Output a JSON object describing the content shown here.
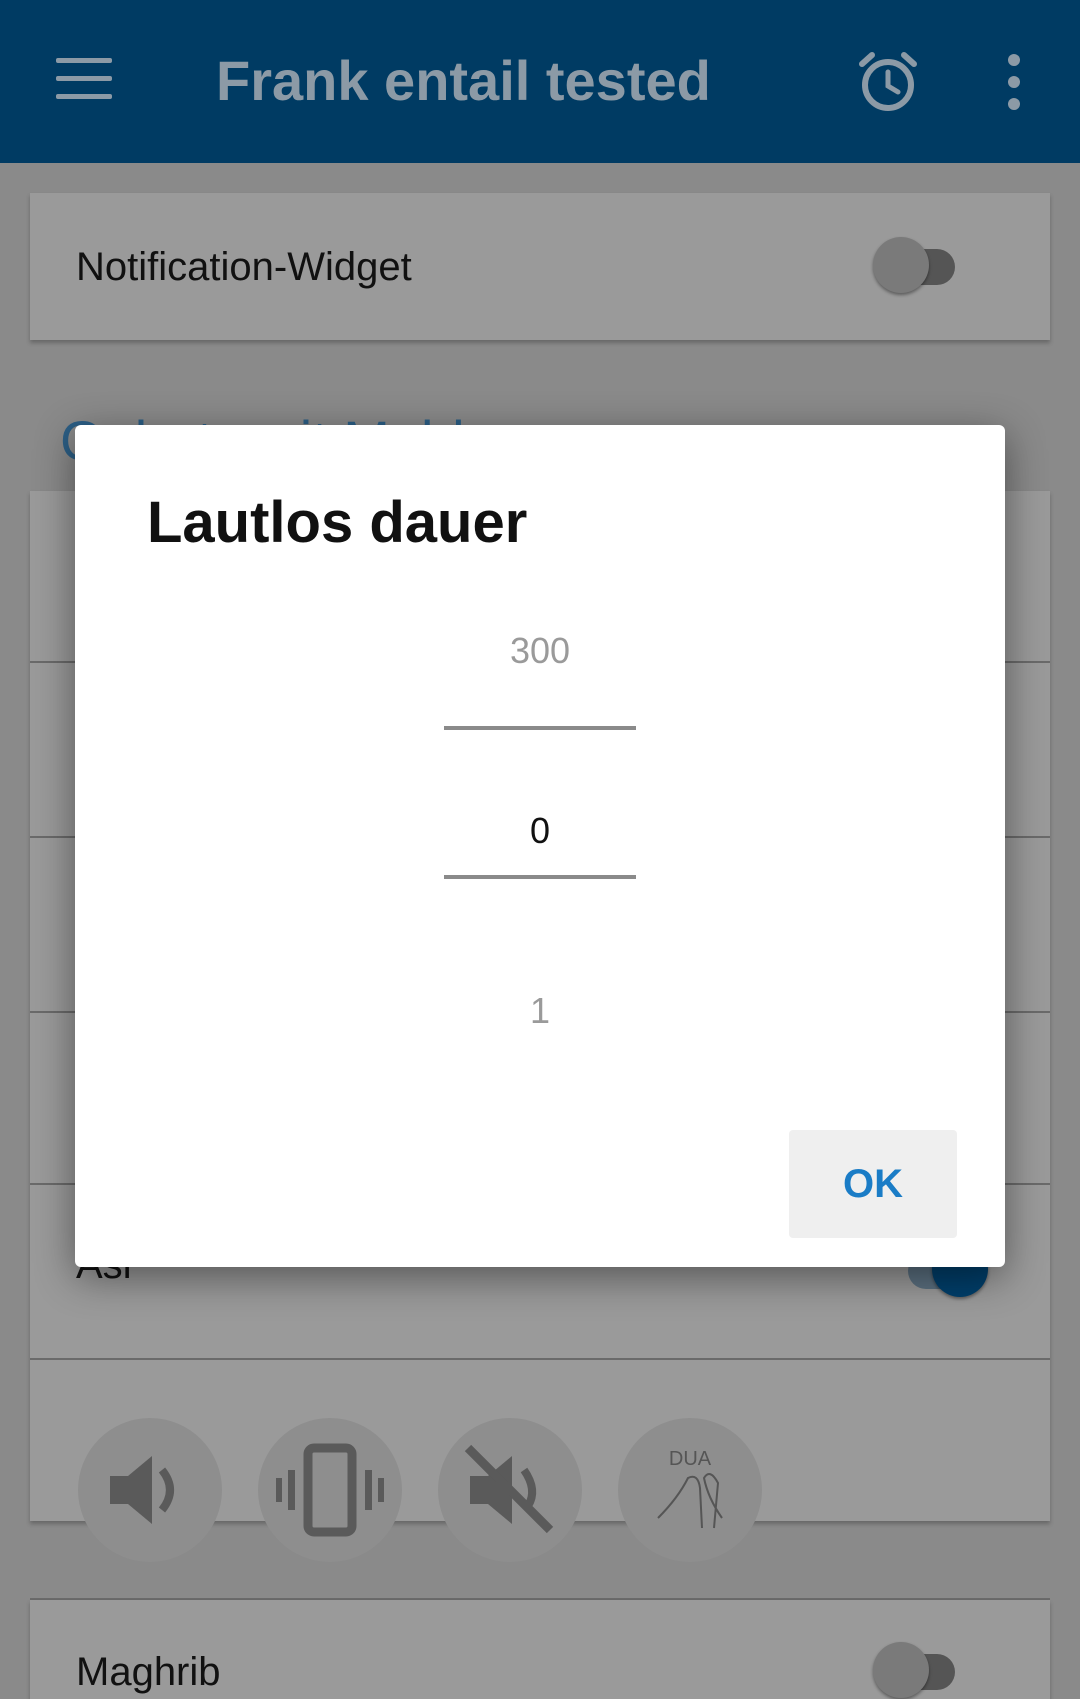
{
  "appbar": {
    "title": "Frank entail tested",
    "menu_icon": "menu-icon",
    "alarm_icon": "alarm-clock-icon",
    "more_icon": "more-vert-icon",
    "color": "#003b63"
  },
  "background": {
    "notification_widget_label": "Notification-Widget",
    "section_heading": "Gebetszeit Meldungen",
    "asr_label": "Asr",
    "maghrib_label": "Maghrib",
    "dua_label": "DUA",
    "mode_icons": [
      "speaker-icon",
      "vibrate-icon",
      "mute-icon",
      "dua-hands-icon"
    ]
  },
  "dialog": {
    "title": "Lautlos dauer",
    "picker": {
      "previous": "300",
      "current": "0",
      "next": "1"
    },
    "ok_label": "OK",
    "accent_color": "#1a7cc6"
  }
}
